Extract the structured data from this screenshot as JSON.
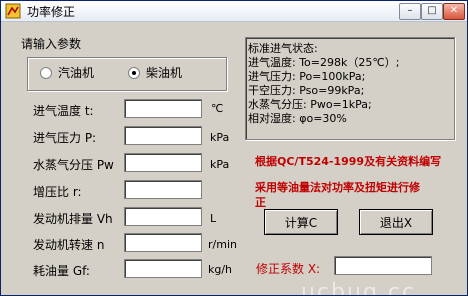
{
  "window": {
    "title": "功率修正"
  },
  "section": {
    "prompt": "请输入参数"
  },
  "engine": {
    "option1": "汽油机",
    "option2": "柴油机",
    "selected": "柴油机"
  },
  "fields": [
    {
      "label": "进气温度 t:",
      "unit": "℃",
      "value": ""
    },
    {
      "label": "进气压力 P:",
      "unit": "kPa",
      "value": ""
    },
    {
      "label": "水蒸气分压 Pw",
      "unit": "kPa",
      "value": ""
    },
    {
      "label": "增压比 r:",
      "unit": "",
      "value": ""
    },
    {
      "label": "发动机排量 Vh",
      "unit": "L",
      "value": ""
    },
    {
      "label": "发动机转速 n",
      "unit": "r/min",
      "value": ""
    },
    {
      "label": "耗油量 Gf:",
      "unit": "kg/h",
      "value": ""
    }
  ],
  "status": {
    "lines": [
      "标准进气状态:",
      "进气温度: To=298k（25℃）;",
      "进气压力: Po=100kPa;",
      "干空压力: Pso=99kPa;",
      "水蒸气分压: Pwo=1kPa;",
      "相对湿度: φo=30%"
    ]
  },
  "notes": {
    "basis": "根据QC/T524-1999及有关资料编写",
    "method1": "采用等油量法对功率及扭矩进行修",
    "method2": "正"
  },
  "buttons": {
    "calc": "计算C",
    "exit": "退出X"
  },
  "coef": {
    "label": "修正系数 X:",
    "value": ""
  },
  "watermark": "ucbug.cc"
}
